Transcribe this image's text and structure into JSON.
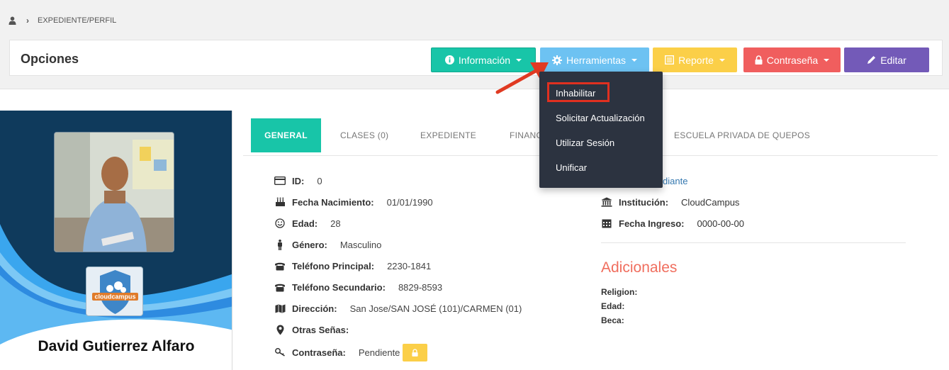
{
  "breadcrumb": {
    "icon": "user-icon",
    "separator_icon": "chevron-right-icon",
    "current": "EXPEDIENTE/PERFIL"
  },
  "toolbar": {
    "title": "Opciones",
    "buttons": [
      {
        "label": "Información",
        "icon": "info-icon",
        "color": "#18c5a8",
        "dropdown": true
      },
      {
        "label": "Herramientas",
        "icon": "gear-icon",
        "color": "#6dc2f2",
        "dropdown": true
      },
      {
        "label": "Reporte",
        "icon": "list-icon",
        "color": "#fbcf48",
        "dropdown": true
      },
      {
        "label": "Contraseña",
        "icon": "lock-icon",
        "color": "#f05e5e",
        "dropdown": true
      },
      {
        "label": "Editar",
        "icon": "pencil-icon",
        "color": "#735ab8",
        "dropdown": false
      }
    ]
  },
  "herramientas_menu": {
    "items": [
      "Inhabilitar",
      "Solicitar Actualización",
      "Utilizar Sesión",
      "Unificar"
    ],
    "highlighted": "Inhabilitar",
    "highlight_color": "#e03020"
  },
  "profile": {
    "name": "David Gutierrez Alfaro",
    "logo_text": "cloudcampus"
  },
  "tabs": [
    "GENERAL",
    "CLASES (0)",
    "EXPEDIENTE",
    "FINANC",
    "ESCUELA PRIVADA DE QUEPOS"
  ],
  "active_tab": "GENERAL",
  "general": [
    {
      "icon": "id-card-icon",
      "label": "ID:",
      "value": "0"
    },
    {
      "icon": "birthday-cake-icon",
      "label": "Fecha Nacimiento:",
      "value": "01/01/1990"
    },
    {
      "icon": "smile-icon",
      "label": "Edad:",
      "value": "28"
    },
    {
      "icon": "male-icon",
      "label": "Género:",
      "value": "Masculino"
    },
    {
      "icon": "phone-icon",
      "label": "Teléfono Principal:",
      "value": "2230-1841"
    },
    {
      "icon": "phone-icon",
      "label": "Teléfono Secundario:",
      "value": "8829-8593"
    },
    {
      "icon": "map-icon",
      "label": "Dirección:",
      "value": "San Jose/SAN JOSÉ (101)/CARMEN (01)"
    },
    {
      "icon": "map-marker-icon",
      "label": "Otras Señas:",
      "value": ""
    },
    {
      "icon": "key-icon",
      "label": "Contraseña:",
      "value": "Pendiente"
    }
  ],
  "right": {
    "role_fragment": "diante",
    "institucion_label": "Institución:",
    "institucion_value": "CloudCampus",
    "ingreso_label": "Fecha Ingreso:",
    "ingreso_value": "0000-00-00"
  },
  "adicionales": {
    "title": "Adicionales",
    "items": [
      "Religion:",
      "Edad:",
      "Beca:"
    ]
  }
}
